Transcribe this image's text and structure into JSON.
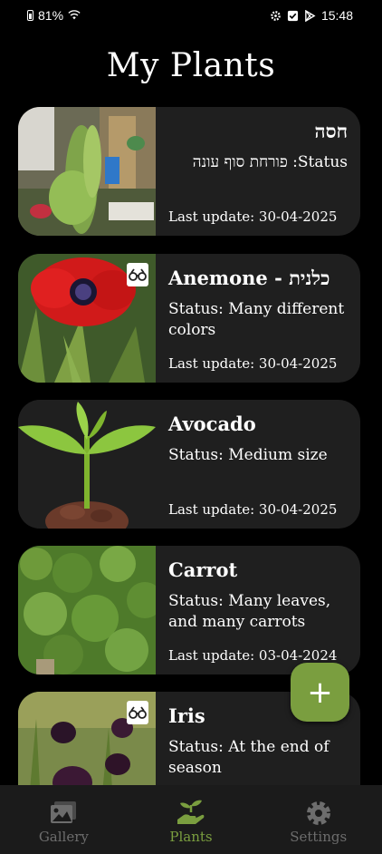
{
  "status_bar": {
    "battery": "81%",
    "time": "15:48"
  },
  "title": "My Plants",
  "plants": [
    {
      "name": "חסה",
      "status": "Status: פורחת סוף עונה",
      "date": "Last update: 30-04-2025"
    },
    {
      "name": "Anemone - כלנית",
      "status": "Status: Many different colors",
      "date": "Last update: 30-04-2025"
    },
    {
      "name": "Avocado",
      "status": "Status: Medium size",
      "date": "Last update: 30-04-2025"
    },
    {
      "name": "Carrot",
      "status": "Status: Many leaves, and many carrots",
      "date": "Last update: 03-04-2024"
    },
    {
      "name": "Iris",
      "status": "Status: At the end of season",
      "date": ""
    }
  ],
  "fab": {
    "label": "+"
  },
  "nav": [
    {
      "label": "Gallery",
      "icon": "gallery-icon"
    },
    {
      "label": "Plants",
      "icon": "plant-hand-icon"
    },
    {
      "label": "Settings",
      "icon": "gear-icon"
    }
  ],
  "colors": {
    "background": "#000000",
    "card": "#1f1f1f",
    "accent": "#7a9e3f",
    "nav_bg": "#1b1b1b",
    "nav_inactive": "#6d6d6d"
  }
}
